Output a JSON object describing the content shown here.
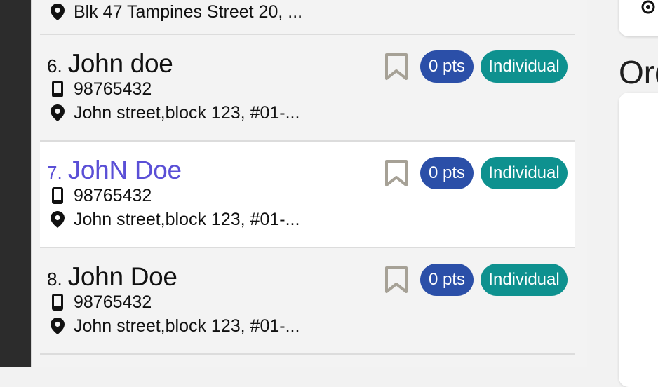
{
  "customers": [
    {
      "number": "",
      "name": "",
      "phone": "",
      "address": "Blk 47 Tampines Street 20, ...",
      "points": "",
      "tag": "",
      "selected": false,
      "partial": true
    },
    {
      "number": "6.",
      "name": "John doe",
      "phone": "98765432",
      "address": "John street,block 123, #01-...",
      "points": "0 pts",
      "tag": "Individual",
      "selected": false
    },
    {
      "number": "7.",
      "name": "JohN Doe",
      "phone": "98765432",
      "address": "John street,block 123, #01-...",
      "points": "0 pts",
      "tag": "Individual",
      "selected": true
    },
    {
      "number": "8.",
      "name": "John Doe",
      "phone": "98765432",
      "address": "John street,block 123, #01-...",
      "points": "0 pts",
      "tag": "Individual",
      "selected": false
    }
  ],
  "right_panel": {
    "title": "Ord"
  },
  "colors": {
    "selected_text": "#5a4fd6",
    "points_pill": "#2b4fa8",
    "tag_pill": "#0e918f"
  },
  "icons": {
    "phone": "phone-icon",
    "address": "location-pin-icon",
    "bookmark": "bookmark-icon",
    "top_right": "add-location-icon"
  }
}
